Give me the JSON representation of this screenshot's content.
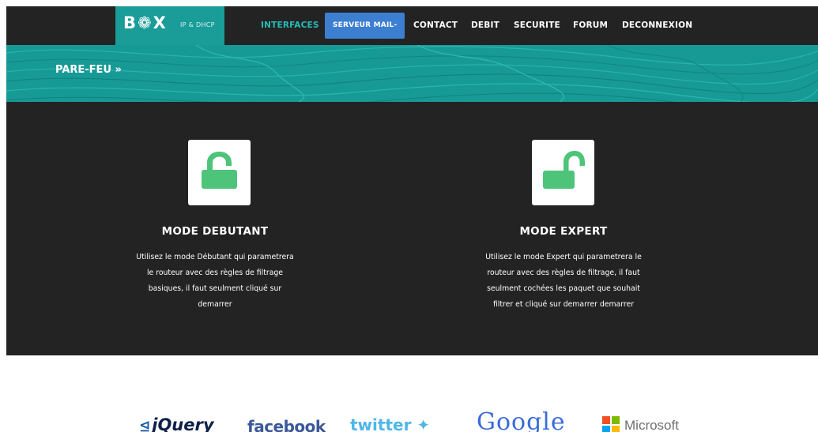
{
  "brand": {
    "logo": "B❁X",
    "subtitle": "IP & DHCP"
  },
  "nav": {
    "items": [
      {
        "label": "INTERFACES"
      },
      {
        "label": "SERVEUR MAIL-"
      },
      {
        "label": "CONTACT"
      },
      {
        "label": "DEBIT"
      },
      {
        "label": "SECURITE"
      },
      {
        "label": "FORUM"
      },
      {
        "label": "DECONNEXION"
      }
    ]
  },
  "banner": {
    "title": "PARE-FEU »"
  },
  "features": [
    {
      "icon": "lock-closed-icon",
      "title": "MODE DEBUTANT",
      "lines": [
        "Utilisez le mode Débutant qui parametrera",
        "le routeur avec des règles de filtrage",
        "basiques, il faut seulment cliqué sur",
        "demarrer"
      ]
    },
    {
      "icon": "lock-open-icon",
      "title": "MODE EXPERT",
      "lines": [
        "Utilisez le mode Expert qui parametrera le",
        "routeur avec des règles de filtrage, il faut",
        "seulment cochées les paquet que souhait",
        "filtrer et cliqué sur demarrer demarrer"
      ]
    }
  ],
  "logos": {
    "jquery": "jQuery",
    "facebook": "facebook",
    "twitter": "twitter",
    "google": "Google",
    "microsoft": "Microsoft"
  },
  "colors": {
    "teal": "#1a9c98",
    "dark": "#232323",
    "lock_green": "#4ec47a",
    "dropdown_blue": "#3c7fd1"
  }
}
